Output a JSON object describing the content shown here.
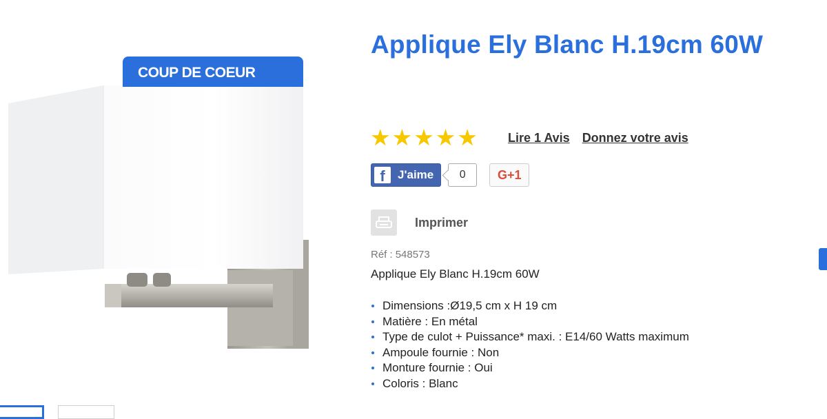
{
  "badge": {
    "label": "COUP DE COEUR"
  },
  "product": {
    "title": "Applique Ely Blanc H.19cm 60W",
    "rating": 5,
    "rating_max": 5,
    "read_reviews_label": "Lire 1 Avis",
    "give_review_label": "Donnez votre avis",
    "ref_label": "Réf :",
    "ref_value": "548573",
    "description": "Applique Ely Blanc H.19cm 60W",
    "specs": [
      "Dimensions :Ø19,5 cm x H 19 cm",
      "Matière : En métal",
      "Type de culot + Puissance* maxi. : E14/60 Watts maximum",
      "Ampoule fournie : Non",
      "Monture fournie : Oui",
      "Coloris : Blanc"
    ]
  },
  "social": {
    "fb_icon": "f",
    "fb_label": "J'aime",
    "fb_count": "0",
    "gplus_label": "G+1"
  },
  "print": {
    "label": "Imprimer",
    "icon": "printer-icon"
  },
  "icons": {
    "star": "★"
  },
  "colors": {
    "accent": "#2a6fdb",
    "star": "#f5c800",
    "facebook": "#4465b0",
    "gplus": "#dd4b39"
  }
}
